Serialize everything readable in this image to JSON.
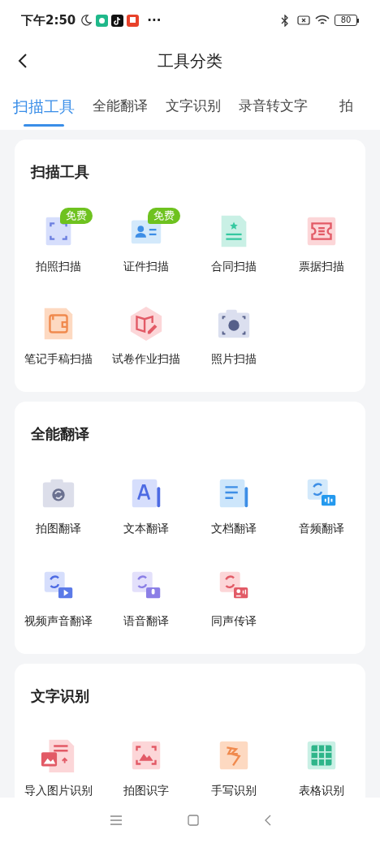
{
  "status_bar": {
    "time": "下午2:50",
    "more": "···",
    "battery": "80"
  },
  "header": {
    "title": "工具分类"
  },
  "tabs": [
    {
      "label": "扫描工具",
      "selected": true
    },
    {
      "label": "全能翻译",
      "selected": false
    },
    {
      "label": "文字识别",
      "selected": false
    },
    {
      "label": "录音转文字",
      "selected": false
    },
    {
      "label": "拍",
      "selected": false
    }
  ],
  "sections": [
    {
      "title": "扫描工具",
      "items": [
        {
          "label": "拍照扫描",
          "badge": "免费"
        },
        {
          "label": "证件扫描",
          "badge": "免费"
        },
        {
          "label": "合同扫描"
        },
        {
          "label": "票据扫描"
        },
        {
          "label": "笔记手稿扫描"
        },
        {
          "label": "试卷作业扫描"
        },
        {
          "label": "照片扫描"
        }
      ]
    },
    {
      "title": "全能翻译",
      "items": [
        {
          "label": "拍图翻译"
        },
        {
          "label": "文本翻译"
        },
        {
          "label": "文档翻译"
        },
        {
          "label": "音频翻译"
        },
        {
          "label": "视频声音翻译"
        },
        {
          "label": "语音翻译"
        },
        {
          "label": "同声传译"
        }
      ]
    },
    {
      "title": "文字识别",
      "items": [
        {
          "label": "导入图片识别"
        },
        {
          "label": "拍图识字"
        },
        {
          "label": "手写识别"
        },
        {
          "label": "表格识别"
        }
      ]
    }
  ]
}
